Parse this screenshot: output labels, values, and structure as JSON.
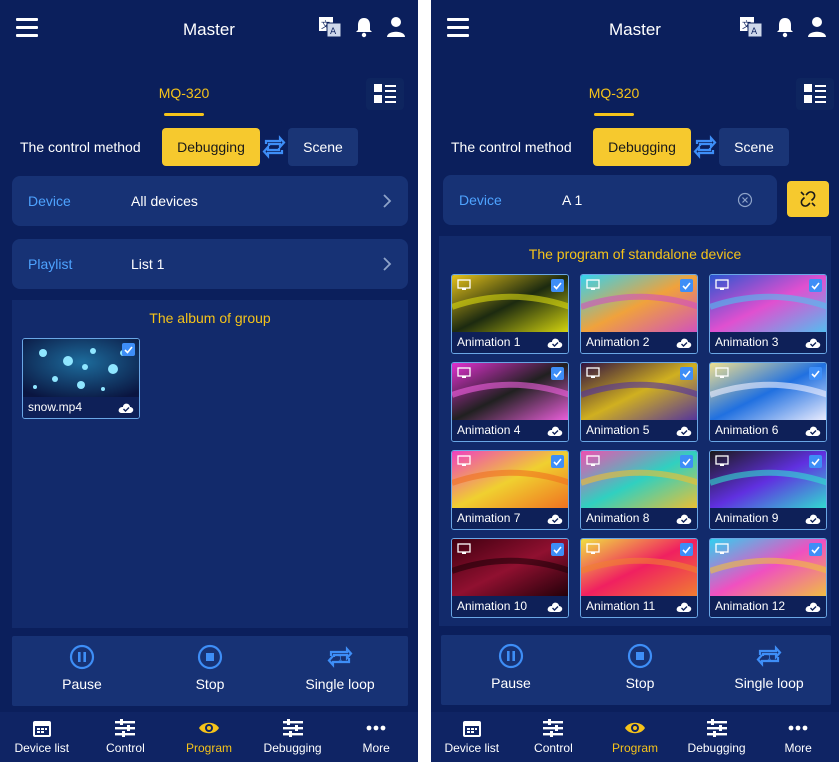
{
  "left": {
    "title": "Master",
    "model": "MQ-320",
    "control_method_label": "The control method",
    "debugging_label": "Debugging",
    "scene_label": "Scene",
    "device": {
      "label": "Device",
      "value": "All devices"
    },
    "playlist": {
      "label": "Playlist",
      "value": "List 1"
    },
    "album_title": "The album of group",
    "media": [
      {
        "name": "snow.mp4"
      }
    ],
    "actions": {
      "pause": "Pause",
      "stop": "Stop",
      "loop": "Single loop"
    }
  },
  "right": {
    "title": "Master",
    "model": "MQ-320",
    "control_method_label": "The control method",
    "debugging_label": "Debugging",
    "scene_label": "Scene",
    "device": {
      "label": "Device",
      "value": "A 1"
    },
    "program_title": "The program of standalone device",
    "programs": [
      {
        "name": "Animation 1"
      },
      {
        "name": "Animation 2"
      },
      {
        "name": "Animation 3"
      },
      {
        "name": "Animation 4"
      },
      {
        "name": "Animation 5"
      },
      {
        "name": "Animation 6"
      },
      {
        "name": "Animation 7"
      },
      {
        "name": "Animation 8"
      },
      {
        "name": "Animation 9"
      },
      {
        "name": "Animation 10"
      },
      {
        "name": "Animation 11"
      },
      {
        "name": "Animation 12"
      }
    ],
    "actions": {
      "pause": "Pause",
      "stop": "Stop",
      "loop": "Single loop"
    }
  },
  "nav": {
    "device_list": "Device list",
    "control": "Control",
    "program": "Program",
    "debugging": "Debugging",
    "more": "More"
  },
  "colors": {
    "accent": "#f5c31a",
    "background": "#0b1f5c",
    "link": "#4ea3ff"
  }
}
